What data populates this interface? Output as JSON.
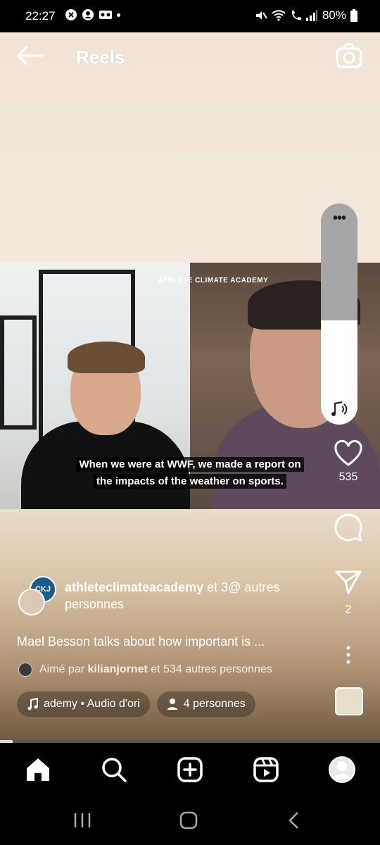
{
  "status_bar": {
    "time": "22:27",
    "battery": "80%"
  },
  "header": {
    "title": "Reels"
  },
  "video": {
    "overlay_logo": "ATHLETE CLIMATE ACADEMY",
    "caption_line1": "When we were at WWF, we made a report on",
    "caption_line2": "the impacts of the weather on sports."
  },
  "actions": {
    "likes": "535",
    "shares": "2"
  },
  "post": {
    "author": "athleteclimateacademy",
    "coauthors": "et 3@ autres personnes",
    "avatar_initials": "CKJ",
    "description": "Mael Besson talks about how important is ...",
    "liked_prefix": "Aimé par",
    "liked_user": "kilianjornet",
    "liked_suffix": "et 534 autres personnes",
    "audio_label": "ademy • Audio d'ori",
    "people_label": "4 personnes"
  },
  "colors": {
    "accent": "#ffffff",
    "background": "#000000"
  }
}
